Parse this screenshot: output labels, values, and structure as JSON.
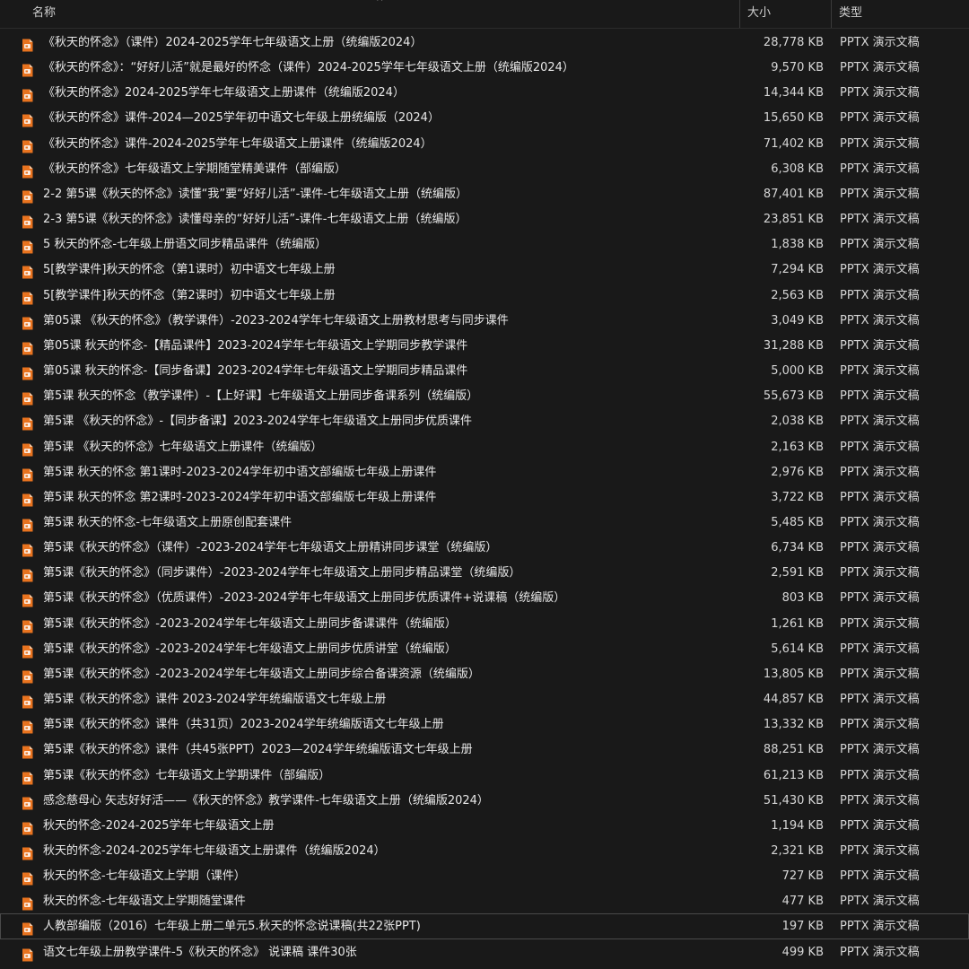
{
  "header": {
    "name_label": "名称",
    "size_label": "大小",
    "type_label": "类型",
    "sort_indicator": "^"
  },
  "icon": {
    "name": "pptx-file-icon",
    "color": "#e8731f",
    "accent": "#f7c9a3"
  },
  "files": [
    {
      "name": "《秋天的怀念》（课件）2024-2025学年七年级语文上册（统编版2024）",
      "size": "28,778 KB",
      "type": "PPTX 演示文稿"
    },
    {
      "name": "《秋天的怀念》：“好好儿活”就是最好的怀念（课件）2024-2025学年七年级语文上册（统编版2024）",
      "size": "9,570 KB",
      "type": "PPTX 演示文稿"
    },
    {
      "name": "《秋天的怀念》2024-2025学年七年级语文上册课件（统编版2024）",
      "size": "14,344 KB",
      "type": "PPTX 演示文稿"
    },
    {
      "name": "《秋天的怀念》课件-2024—2025学年初中语文七年级上册统编版（2024）",
      "size": "15,650 KB",
      "type": "PPTX 演示文稿"
    },
    {
      "name": "《秋天的怀念》课件-2024-2025学年七年级语文上册课件（统编版2024）",
      "size": "71,402 KB",
      "type": "PPTX 演示文稿"
    },
    {
      "name": "《秋天的怀念》七年级语文上学期随堂精美课件（部编版）",
      "size": "6,308 KB",
      "type": "PPTX 演示文稿"
    },
    {
      "name": "2-2 第5课《秋天的怀念》读懂“我”要“好好儿活”-课件-七年级语文上册（统编版）",
      "size": "87,401 KB",
      "type": "PPTX 演示文稿"
    },
    {
      "name": "2-3 第5课《秋天的怀念》读懂母亲的“好好儿活”-课件-七年级语文上册（统编版）",
      "size": "23,851 KB",
      "type": "PPTX 演示文稿"
    },
    {
      "name": "5 秋天的怀念-七年级上册语文同步精品课件（统编版）",
      "size": "1,838 KB",
      "type": "PPTX 演示文稿"
    },
    {
      "name": "5[教学课件]秋天的怀念（第1课时）初中语文七年级上册",
      "size": "7,294 KB",
      "type": "PPTX 演示文稿"
    },
    {
      "name": "5[教学课件]秋天的怀念（第2课时）初中语文七年级上册",
      "size": "2,563 KB",
      "type": "PPTX 演示文稿"
    },
    {
      "name": "第05课 《秋天的怀念》（教学课件）-2023-2024学年七年级语文上册教材思考与同步课件",
      "size": "3,049 KB",
      "type": "PPTX 演示文稿"
    },
    {
      "name": "第05课 秋天的怀念-【精品课件】2023-2024学年七年级语文上学期同步教学课件",
      "size": "31,288 KB",
      "type": "PPTX 演示文稿"
    },
    {
      "name": "第05课 秋天的怀念-【同步备课】2023-2024学年七年级语文上学期同步精品课件",
      "size": "5,000 KB",
      "type": "PPTX 演示文稿"
    },
    {
      "name": "第5课  秋天的怀念（教学课件）-【上好课】七年级语文上册同步备课系列（统编版）",
      "size": "55,673 KB",
      "type": "PPTX 演示文稿"
    },
    {
      "name": "第5课 《秋天的怀念》-【同步备课】2023-2024学年七年级语文上册同步优质课件",
      "size": "2,038 KB",
      "type": "PPTX 演示文稿"
    },
    {
      "name": "第5课 《秋天的怀念》七年级语文上册课件（统编版）",
      "size": "2,163 KB",
      "type": "PPTX 演示文稿"
    },
    {
      "name": "第5课 秋天的怀念 第1课时-2023-2024学年初中语文部编版七年级上册课件",
      "size": "2,976 KB",
      "type": "PPTX 演示文稿"
    },
    {
      "name": "第5课 秋天的怀念 第2课时-2023-2024学年初中语文部编版七年级上册课件",
      "size": "3,722 KB",
      "type": "PPTX 演示文稿"
    },
    {
      "name": "第5课 秋天的怀念-七年级语文上册原创配套课件",
      "size": "5,485 KB",
      "type": "PPTX 演示文稿"
    },
    {
      "name": "第5课《秋天的怀念》（课件）-2023-2024学年七年级语文上册精讲同步课堂（统编版）",
      "size": "6,734 KB",
      "type": "PPTX 演示文稿"
    },
    {
      "name": "第5课《秋天的怀念》（同步课件）-2023-2024学年七年级语文上册同步精品课堂（统编版）",
      "size": "2,591 KB",
      "type": "PPTX 演示文稿"
    },
    {
      "name": "第5课《秋天的怀念》（优质课件）-2023-2024学年七年级语文上册同步优质课件+说课稿（统编版）",
      "size": "803 KB",
      "type": "PPTX 演示文稿"
    },
    {
      "name": "第5课《秋天的怀念》-2023-2024学年七年级语文上册同步备课课件（统编版）",
      "size": "1,261 KB",
      "type": "PPTX 演示文稿"
    },
    {
      "name": "第5课《秋天的怀念》-2023-2024学年七年级语文上册同步优质讲堂（统编版）",
      "size": "5,614 KB",
      "type": "PPTX 演示文稿"
    },
    {
      "name": "第5课《秋天的怀念》-2023-2024学年七年级语文上册同步综合备课资源（统编版）",
      "size": "13,805 KB",
      "type": "PPTX 演示文稿"
    },
    {
      "name": "第5课《秋天的怀念》课件  2023-2024学年统编版语文七年级上册",
      "size": "44,857 KB",
      "type": "PPTX 演示文稿"
    },
    {
      "name": "第5课《秋天的怀念》课件（共31页）2023-2024学年统编版语文七年级上册",
      "size": "13,332 KB",
      "type": "PPTX 演示文稿"
    },
    {
      "name": "第5课《秋天的怀念》课件（共45张PPT）2023—2024学年统编版语文七年级上册",
      "size": "88,251 KB",
      "type": "PPTX 演示文稿"
    },
    {
      "name": "第5课《秋天的怀念》七年级语文上学期课件（部编版）",
      "size": "61,213 KB",
      "type": "PPTX 演示文稿"
    },
    {
      "name": "感念慈母心 矢志好好活——《秋天的怀念》教学课件-七年级语文上册（统编版2024）",
      "size": "51,430 KB",
      "type": "PPTX 演示文稿"
    },
    {
      "name": "秋天的怀念-2024-2025学年七年级语文上册",
      "size": "1,194 KB",
      "type": "PPTX 演示文稿"
    },
    {
      "name": "秋天的怀念-2024-2025学年七年级语文上册课件（统编版2024）",
      "size": "2,321 KB",
      "type": "PPTX 演示文稿"
    },
    {
      "name": "秋天的怀念-七年级语文上学期（课件）",
      "size": "727 KB",
      "type": "PPTX 演示文稿"
    },
    {
      "name": "秋天的怀念-七年级语文上学期随堂课件",
      "size": "477 KB",
      "type": "PPTX 演示文稿"
    },
    {
      "name": "人教部编版（2016）七年级上册二单元5.秋天的怀念说课稿(共22张PPT)",
      "size": "197 KB",
      "type": "PPTX 演示文稿",
      "focused": true
    },
    {
      "name": "语文七年级上册教学课件-5《秋天的怀念》 说课稿 课件30张",
      "size": "499 KB",
      "type": "PPTX 演示文稿"
    }
  ]
}
